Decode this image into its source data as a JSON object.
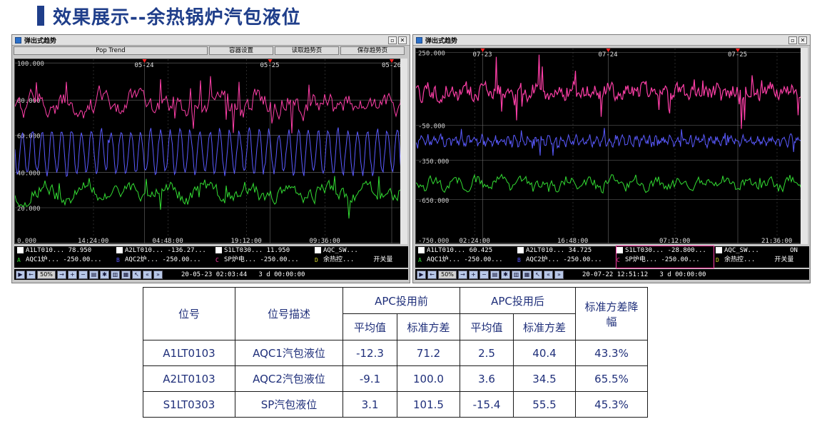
{
  "slide_title": "效果展示--余热锅炉汽包液位",
  "windows": [
    {
      "title": "弹出式趋势",
      "toolbar": [
        "Pop Trend",
        "容器设置",
        "读取趋势页",
        "保存趋势页"
      ],
      "y_labels": [
        "100.000",
        "80.000",
        "60.000",
        "40.000",
        "20.000",
        "0.000"
      ],
      "date_labels": [
        "05-24",
        "05-25",
        "05-26"
      ],
      "time_labels": [
        "14:24:00",
        "04:48:00",
        "19:12:00",
        "09:36:00"
      ],
      "legend": [
        {
          "tag": "A1LT010...",
          "value": "78.950",
          "letter": "A",
          "desc": "AQC1炉...",
          "low": "-250.00..."
        },
        {
          "tag": "A2LT010...",
          "value": "-136.27...",
          "letter": "B",
          "desc": "AQC2炉...",
          "low": "-250.00..."
        },
        {
          "tag": "S1LT030...",
          "value": "11.950",
          "letter": "C",
          "desc": "SP炉电...",
          "low": "-250.00..."
        },
        {
          "tag": "AQC_SW...",
          "value": "",
          "letter": "D",
          "desc": "余热控...",
          "low": "开关量"
        }
      ],
      "zoom": "50%",
      "datetime": "20-05-23 02:03:44",
      "span": "3 d 00:00:00"
    },
    {
      "title": "弹出式趋势",
      "y_labels": [
        "250.000",
        "-50.000",
        "-350.000",
        "-650.000",
        "-750.000"
      ],
      "date_labels": [
        "07-23",
        "07-24",
        "07-25"
      ],
      "time_labels": [
        "02:24:00",
        "16:48:00",
        "07:12:00",
        "21:36:00"
      ],
      "legend": [
        {
          "tag": "A1LT010...",
          "value": "60.425",
          "letter": "A",
          "desc": "AQC1炉...",
          "low": "-250.00..."
        },
        {
          "tag": "A2LT010...",
          "value": "34.725",
          "letter": "B",
          "desc": "AQC2炉...",
          "low": "-250.00..."
        },
        {
          "tag": "S1LT030...",
          "value": "-28.800...",
          "letter": "C",
          "desc": "SP炉电...",
          "low": "-250.00..."
        },
        {
          "tag": "AQC_SW...",
          "value": "ON",
          "letter": "D",
          "desc": "余热控...",
          "low": "开关量"
        }
      ],
      "zoom": "50%",
      "datetime": "20-07-22 12:51:12",
      "span": "3 d 00:00:00"
    }
  ],
  "table": {
    "headers": {
      "tag": "位号",
      "desc": "位号描述",
      "before": "APC投用前",
      "after": "APC投用后",
      "reduction": "标准方差降幅",
      "mean": "平均值",
      "std": "标准方差"
    },
    "rows": [
      [
        "A1LT0103",
        "AQC1汽包液位",
        "-12.3",
        "71.2",
        "2.5",
        "40.4",
        "43.3%"
      ],
      [
        "A2LT0103",
        "AQC2汽包液位",
        "-9.1",
        "100.0",
        "3.6",
        "34.5",
        "65.5%"
      ],
      [
        "S1LT0303",
        "SP汽包液位",
        "3.1",
        "101.5",
        "-15.4",
        "55.5",
        "45.3%"
      ]
    ]
  },
  "colors": {
    "title_blue": "#1f3e8a",
    "trend_magenta": "#ff3fa8",
    "trend_blue": "#5a5aff",
    "trend_green": "#33dd33",
    "table_text": "#1f2f7a"
  }
}
